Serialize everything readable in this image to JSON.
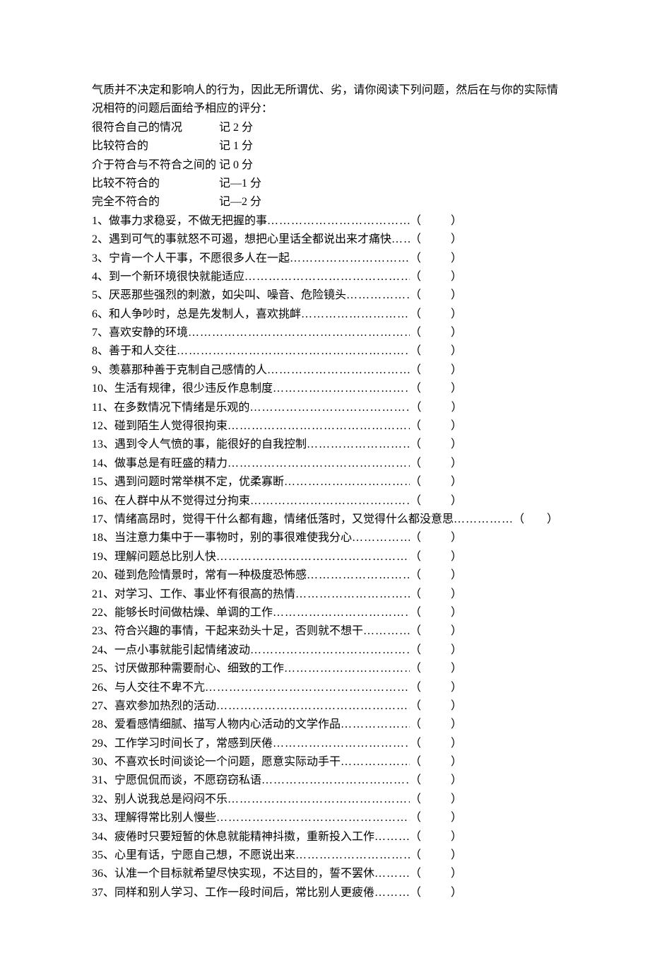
{
  "intro": "气质并不决定和影响人的行为，因此无所谓优、劣，请你阅读下列问题，然后在与你的实际情况相符的问题后面给予相应的评分：",
  "scoring": [
    {
      "label": "很符合自己的情况",
      "value": "记 2 分"
    },
    {
      "label": "比较符合的",
      "value": "记 1 分"
    },
    {
      "label": "介于符合与不符合之间的",
      "value": "记 0 分"
    },
    {
      "label": "比较不符合的",
      "value": "记—1 分"
    },
    {
      "label": "完全不符合的",
      "value": "记—2 分"
    }
  ],
  "questions": [
    {
      "n": "1",
      "text": "做事力求稳妥，不做无把握的事"
    },
    {
      "n": "2",
      "text": "遇到可气的事就怒不可遏，想把心里话全都说出来才痛快"
    },
    {
      "n": "3",
      "text": "宁肯一个人干事，不愿很多人在一起"
    },
    {
      "n": "4",
      "text": "到一个新环境很快就能适应"
    },
    {
      "n": "5",
      "text": "厌恶那些强烈的刺激，如尖叫、噪音、危险镜头"
    },
    {
      "n": "6",
      "text": "和人争吵时，总是先发制人，喜欢挑衅"
    },
    {
      "n": "7",
      "text": "喜欢安静的环境"
    },
    {
      "n": "8",
      "text": "善于和人交往"
    },
    {
      "n": "9",
      "text": "羡慕那种善于克制自己感情的人"
    },
    {
      "n": "10",
      "text": "生活有规律，很少违反作息制度"
    },
    {
      "n": "11",
      "text": "在多数情况下情绪是乐观的"
    },
    {
      "n": "12",
      "text": "碰到陌生人觉得很拘束"
    },
    {
      "n": "13",
      "text": "遇到令人气愤的事，能很好的自我控制"
    },
    {
      "n": "14",
      "text": "做事总是有旺盛的精力"
    },
    {
      "n": "15",
      "text": "遇到问题时常举棋不定，优柔寡断"
    },
    {
      "n": "16",
      "text": "在人群中从不觉得过分拘束"
    },
    {
      "n": "17",
      "text": "情绪高昂时，觉得干什么都有趣，情绪低落时，又觉得什么都没意思",
      "wide": true
    },
    {
      "n": "18",
      "text": "当注意力集中于一事物时，别的事很难使我分心"
    },
    {
      "n": "19",
      "text": "理解问题总比别人快"
    },
    {
      "n": "20",
      "text": "碰到危险情景时，常有一种极度恐怖感"
    },
    {
      "n": "21",
      "text": "对学习、工作、事业怀有很高的热情"
    },
    {
      "n": "22",
      "text": "能够长时间做枯燥、单调的工作"
    },
    {
      "n": "23",
      "text": "符合兴趣的事情，干起来劲头十足，否则就不想干"
    },
    {
      "n": "24",
      "text": "一点小事就能引起情绪波动"
    },
    {
      "n": "25",
      "text": "讨厌做那种需要耐心、细致的工作"
    },
    {
      "n": "26",
      "text": "与人交往不卑不亢"
    },
    {
      "n": "27",
      "text": "喜欢参加热烈的活动"
    },
    {
      "n": "28",
      "text": "爱看感情细腻、描写人物内心活动的文学作品"
    },
    {
      "n": "29",
      "text": "工作学习时间长了，常感到厌倦"
    },
    {
      "n": "30",
      "text": "不喜欢长时间谈论一个问题，愿意实际动手干"
    },
    {
      "n": "31",
      "text": "宁愿侃侃而谈，不愿窃窃私语"
    },
    {
      "n": "32",
      "text": "别人说我总是闷闷不乐"
    },
    {
      "n": "33",
      "text": "理解得常比别人慢些"
    },
    {
      "n": "34",
      "text": "疲倦时只要短暂的休息就能精神抖擞，重新投入工作"
    },
    {
      "n": "35",
      "text": "心里有话，宁愿自己想，不愿说出来"
    },
    {
      "n": "36",
      "text": "认准一个目标就希望尽快实现，不达目的，誓不罢休"
    },
    {
      "n": "37",
      "text": "同样和别人学习、工作一段时间后，常比别人更疲倦"
    }
  ],
  "paren_open": "（",
  "paren_close": "）",
  "sep": "、",
  "dots_long": "………………………………………………………………………………"
}
